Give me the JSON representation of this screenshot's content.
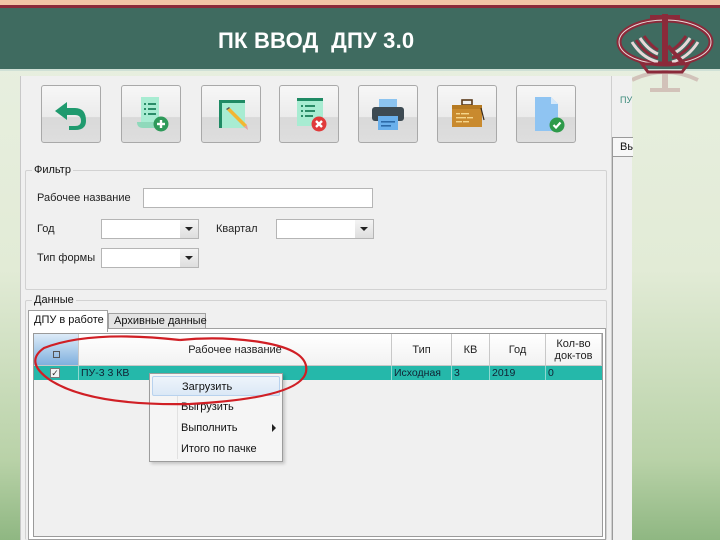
{
  "slide": {
    "title": "ПК ВВОД  ДПУ 3.0",
    "colors": {
      "header_bg": "#3f6b60",
      "header_accent": "#8b2a3a",
      "selected_row": "#25b8aa",
      "annotation": "#d01f25"
    }
  },
  "toolbar": {
    "buttons": [
      {
        "name": "back",
        "icon": "undo-arrow-icon"
      },
      {
        "name": "add-document",
        "icon": "document-add-icon"
      },
      {
        "name": "edit-document",
        "icon": "document-edit-icon"
      },
      {
        "name": "delete-document",
        "icon": "document-delete-icon"
      },
      {
        "name": "print",
        "icon": "printer-icon"
      },
      {
        "name": "archive",
        "icon": "briefcase-icon"
      },
      {
        "name": "validate",
        "icon": "document-check-icon"
      }
    ]
  },
  "side_panel": {
    "label": "ПУ",
    "tab_label": "Вы"
  },
  "filter": {
    "group_label": "Фильтр",
    "work_name_label": "Рабочее название",
    "work_name_value": "",
    "year_label": "Год",
    "year_value": "",
    "quarter_label": "Квартал",
    "quarter_value": "",
    "form_type_label": "Тип формы",
    "form_type_value": ""
  },
  "data": {
    "group_label": "Данные",
    "tabs": [
      {
        "label": "ДПУ в работе",
        "active": true
      },
      {
        "label": "Архивные данные",
        "active": false
      }
    ],
    "columns": [
      "",
      "Рабочее название",
      "Тип",
      "КВ",
      "Год",
      "Кол-во док-тов"
    ],
    "rows": [
      {
        "checked": true,
        "check_mark": "✓",
        "name": "ПУ-3 3 КВ",
        "type": "Исходная",
        "quarter": "3",
        "year": "2019",
        "doc_count": "0"
      }
    ]
  },
  "context_menu": {
    "items": [
      {
        "label": "Загрузить",
        "highlighted": true,
        "submenu": false
      },
      {
        "label": "Выгрузить",
        "highlighted": false,
        "submenu": false
      },
      {
        "label": "Выполнить",
        "highlighted": false,
        "submenu": true
      },
      {
        "label": "Итого по пачке",
        "highlighted": false,
        "submenu": false
      }
    ]
  }
}
